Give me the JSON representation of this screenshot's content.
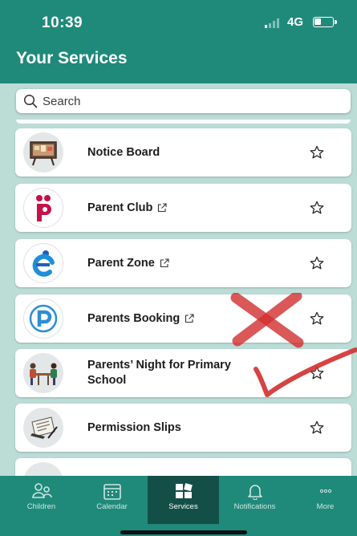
{
  "status": {
    "time": "10:39",
    "network": "4G"
  },
  "header": {
    "title": "Your Services"
  },
  "search": {
    "placeholder": "Search"
  },
  "services": [
    {
      "label": "Notice Board",
      "icon": "notice-board-icon",
      "external": false
    },
    {
      "label": "Parent Club",
      "icon": "parent-club-logo-icon",
      "external": true
    },
    {
      "label": "Parent Zone",
      "icon": "parent-zone-logo-icon",
      "external": true
    },
    {
      "label": "Parents Booking",
      "icon": "parents-booking-logo-icon",
      "external": true
    },
    {
      "label": "Parents’ Night for Primary School",
      "icon": "parents-night-icon",
      "external": false
    },
    {
      "label": "Permission Slips",
      "icon": "permission-slips-icon",
      "external": false
    }
  ],
  "tabs": [
    {
      "label": "Children",
      "icon": "children-icon"
    },
    {
      "label": "Calendar",
      "icon": "calendar-icon"
    },
    {
      "label": "Services",
      "icon": "services-icon",
      "active": true
    },
    {
      "label": "Notifications",
      "icon": "bell-icon"
    },
    {
      "label": "More",
      "icon": "more-dots-icon"
    }
  ],
  "colors": {
    "brand": "#1f8a7a",
    "active_tab": "#134f47",
    "background": "#bcdcd6",
    "annotation": "#d32f2f"
  }
}
